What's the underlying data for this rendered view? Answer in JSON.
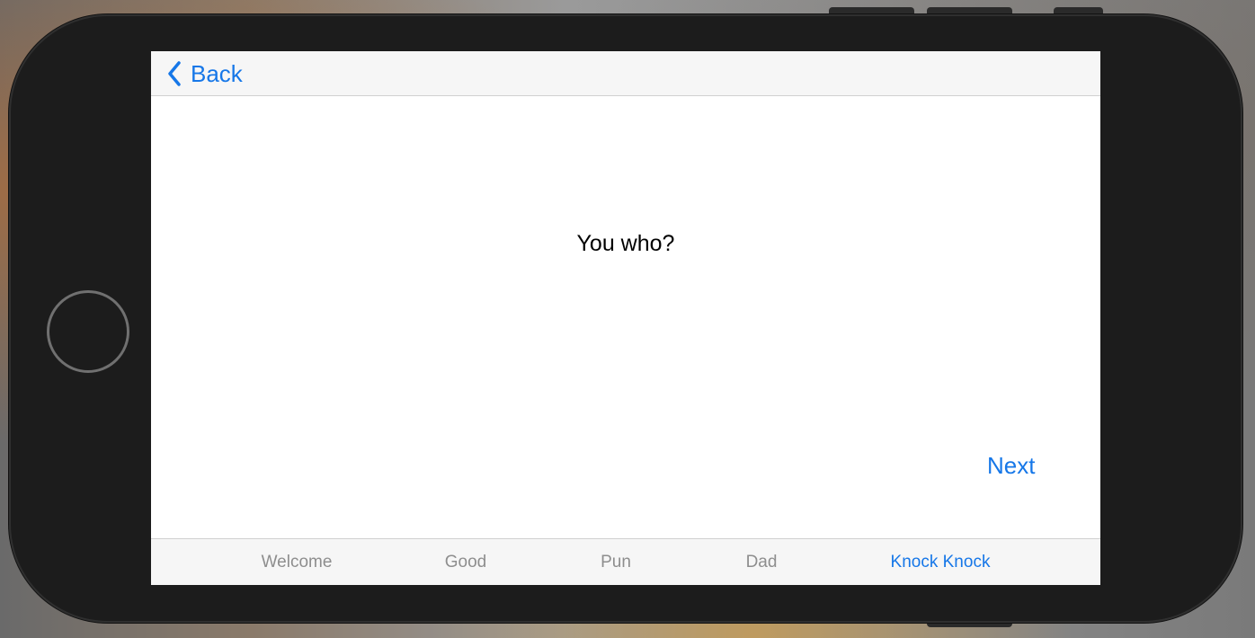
{
  "nav": {
    "back_label": "Back"
  },
  "content": {
    "joke_line": "You who?",
    "next_label": "Next"
  },
  "tabbar": {
    "active": "Knock Knock",
    "tabs": [
      {
        "label": "Welcome"
      },
      {
        "label": "Good"
      },
      {
        "label": "Pun"
      },
      {
        "label": "Dad"
      },
      {
        "label": "Knock Knock"
      }
    ]
  },
  "colors": {
    "accent": "#1677e8",
    "inactive_tab": "#8e8e8e",
    "bar_background": "#f6f6f6",
    "device_body": "#1c1c1c"
  },
  "icons": {
    "back": "chevron-left-icon",
    "home": "home-button-ring"
  }
}
